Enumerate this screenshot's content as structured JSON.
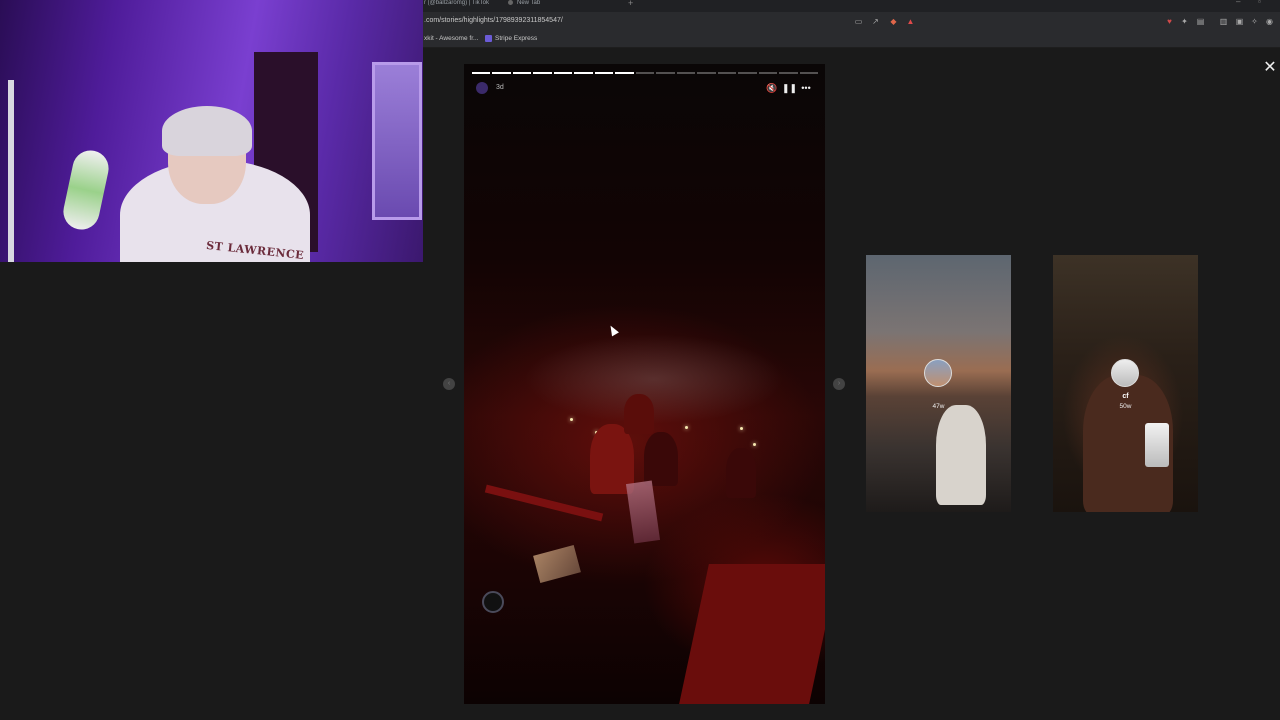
{
  "browser": {
    "tabs": [
      {
        "label": "r (@ballzaromg) | TikTok"
      },
      {
        "label": "New Tab"
      }
    ],
    "url": ".com/stories/highlights/17989392311854547/",
    "bookmarks": [
      {
        "label": "xkit - Awesome fr..."
      },
      {
        "label": "Stripe Express"
      }
    ]
  },
  "story": {
    "posted_ago": "3d",
    "segments_total": 17,
    "segments_done": 8
  },
  "previews": [
    {
      "name": "",
      "posted_ago": "47w"
    },
    {
      "name": "cf",
      "posted_ago": "50w"
    }
  ],
  "webcam": {
    "shirt_text": "ST LAWRENCE"
  },
  "colors": {
    "background": "#1a1a1a",
    "chrome": "#2a2b2e",
    "accent_red": "#6a0d0c",
    "webcam_purple": "#7a3fd0"
  }
}
